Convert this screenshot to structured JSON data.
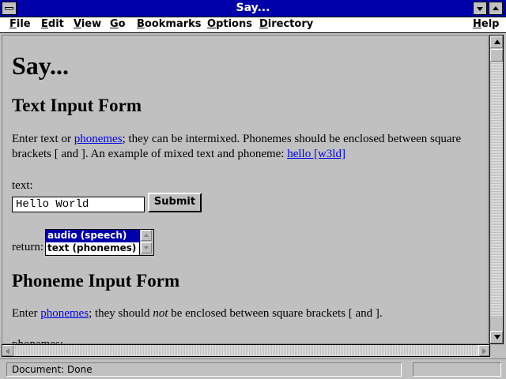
{
  "window": {
    "title": "Say..."
  },
  "menu": {
    "file": "File",
    "edit": "Edit",
    "view": "View",
    "go": "Go",
    "bookmarks": "Bookmarks",
    "options": "Options",
    "directory": "Directory",
    "help": "Help"
  },
  "page": {
    "heading": "Say...",
    "text_form_heading": "Text Input Form",
    "intro": {
      "part1": "Enter text or ",
      "link_phonemes": "phonemes",
      "part2": "; they can be intermixed. Phonemes should be enclosed between square brackets [ and ]. An example of mixed text and phoneme: ",
      "link_example": "hello [w3ld]"
    },
    "text_label": "text:",
    "text_value": "Hello World",
    "submit_label": "Submit",
    "return_label": "return:",
    "return_options": [
      "audio (speech)",
      "text (phonemes)"
    ],
    "return_selected": "audio (speech)",
    "phoneme_form_heading": "Phoneme Input Form",
    "phoneme_intro": {
      "part1": "Enter ",
      "link_phonemes": "phonemes",
      "part2": "; they should ",
      "emph": "not",
      "part3": " be enclosed between square brackets [ and ]."
    },
    "phonemes_label": "phonemes:"
  },
  "status": {
    "text": "Document: Done",
    "progress": 0
  },
  "colors": {
    "titlebar": "#0000aa",
    "link": "#0000ee",
    "selection": "#0000aa",
    "background": "#c0c0c0"
  }
}
